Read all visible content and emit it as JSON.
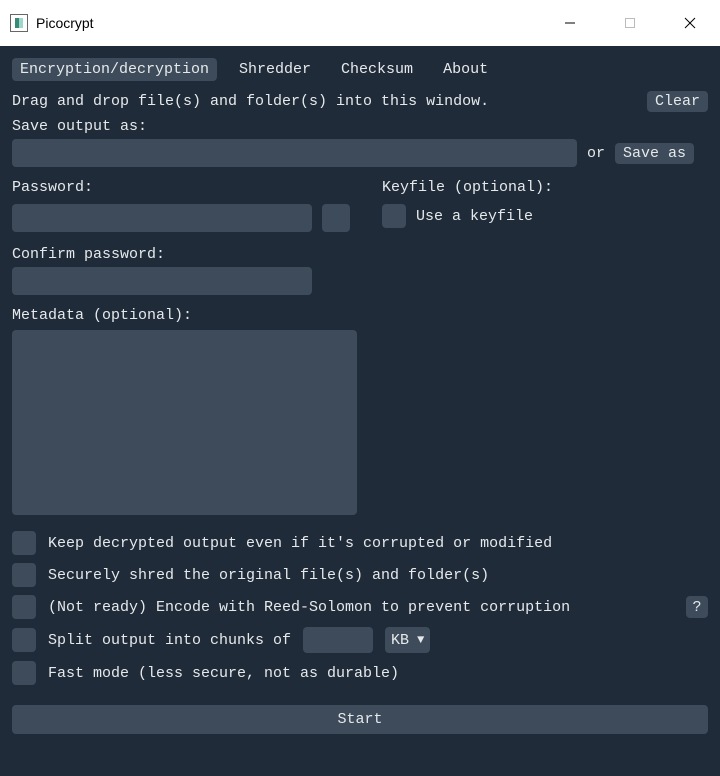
{
  "window": {
    "title": "Picocrypt"
  },
  "tabs": {
    "encryption": "Encryption/decryption",
    "shredder": "Shredder",
    "checksum": "Checksum",
    "about": "About"
  },
  "hint": "Drag and drop file(s) and folder(s) into this window.",
  "buttons": {
    "clear": "Clear",
    "save_as": "Save as",
    "start": "Start",
    "help": "?"
  },
  "labels": {
    "save_output": "Save output as:",
    "or": "or",
    "password": "Password:",
    "keyfile": "Keyfile (optional):",
    "use_keyfile": "Use a keyfile",
    "confirm": "Confirm password:",
    "metadata": "Metadata (optional):"
  },
  "options": {
    "keep_corrupted": "Keep decrypted output even if it's corrupted or modified",
    "shred": "Securely shred the original file(s) and folder(s)",
    "reed_solomon": "(Not ready) Encode with Reed-Solomon to prevent corruption",
    "split": "Split output into chunks of",
    "fast": "Fast mode (less secure, not as durable)"
  },
  "split_unit": "KB",
  "values": {
    "output": "",
    "password": "",
    "confirm": "",
    "metadata": "",
    "chunk_size": ""
  }
}
